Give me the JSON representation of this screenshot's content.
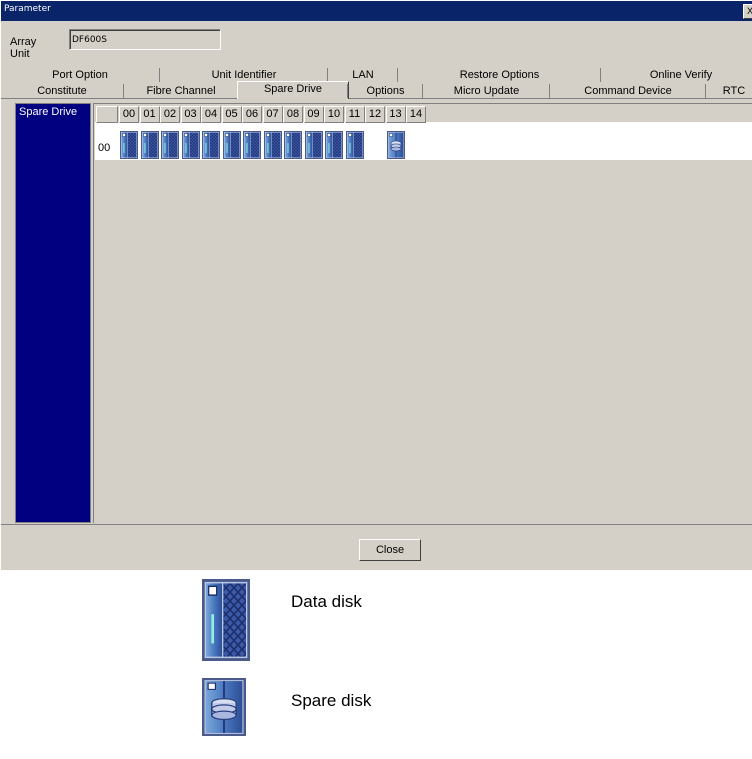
{
  "window": {
    "title": "Parameter",
    "close_glyph": "X"
  },
  "array_unit": {
    "label": "Array Unit",
    "value": "DF600S"
  },
  "tabs_back_row": [
    {
      "label": "Port Option"
    },
    {
      "label": "Unit Identifier"
    },
    {
      "label": "LAN"
    },
    {
      "label": "Restore Options"
    },
    {
      "label": "Online Verify"
    }
  ],
  "tabs_front_row": [
    {
      "label": "Constitute"
    },
    {
      "label": "Fibre Channel"
    },
    {
      "label": "Spare Drive",
      "active": true
    },
    {
      "label": "Options"
    },
    {
      "label": "Micro Update"
    },
    {
      "label": "Command Device"
    },
    {
      "label": "RTC"
    }
  ],
  "left_panel": {
    "label": "Spare Drive"
  },
  "grid": {
    "columns": [
      "00",
      "01",
      "02",
      "03",
      "04",
      "05",
      "06",
      "07",
      "08",
      "09",
      "10",
      "11",
      "12",
      "13",
      "14"
    ],
    "rows": [
      {
        "label": "00",
        "slots": [
          "data",
          "data",
          "data",
          "data",
          "data",
          "data",
          "data",
          "data",
          "data",
          "data",
          "data",
          "data",
          "empty",
          "spare",
          "empty"
        ]
      }
    ]
  },
  "footer": {
    "close_label": "Close"
  },
  "legend": [
    {
      "icon": "data-disk-icon",
      "label": "Data disk"
    },
    {
      "icon": "spare-disk-icon",
      "label": "Spare disk"
    }
  ],
  "colors": {
    "titlebar": "#0a246a",
    "panel_navy": "#000080",
    "dialog_gray": "#d4d0c8"
  }
}
